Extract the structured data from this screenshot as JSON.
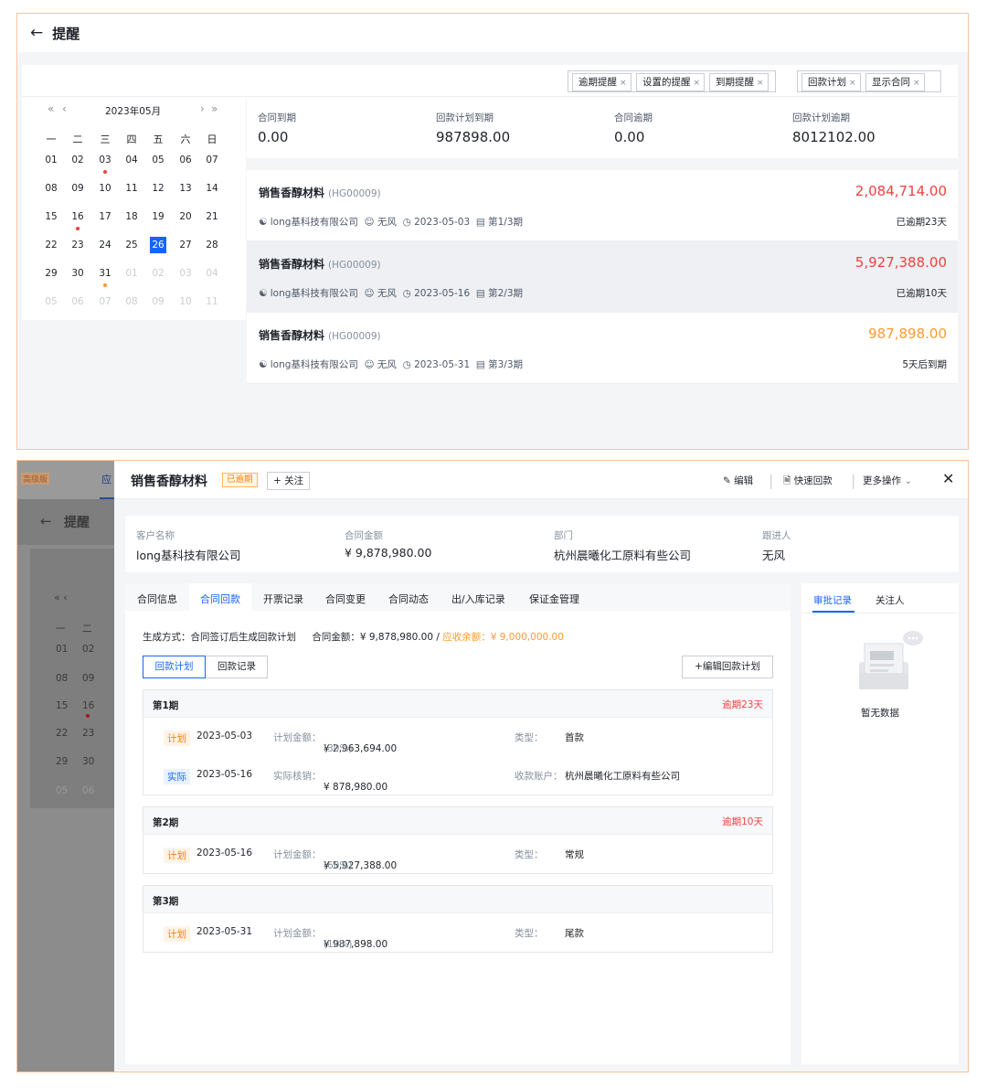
{
  "panel1": {
    "title": "提醒",
    "filters_a": [
      "逾期提醒",
      "设置的提醒",
      "到期提醒"
    ],
    "filters_b": [
      "回款计划",
      "显示合同"
    ],
    "calendar": {
      "month": "2023年05月",
      "weekdays": [
        "一",
        "二",
        "三",
        "四",
        "五",
        "六",
        "日"
      ],
      "weeks": [
        [
          "01",
          "02",
          "03",
          "04",
          "05",
          "06",
          "07"
        ],
        [
          "08",
          "09",
          "10",
          "11",
          "12",
          "13",
          "14"
        ],
        [
          "15",
          "16",
          "17",
          "18",
          "19",
          "20",
          "21"
        ],
        [
          "22",
          "23",
          "24",
          "25",
          "26",
          "27",
          "28"
        ],
        [
          "29",
          "30",
          "31",
          "01",
          "02",
          "03",
          "04"
        ],
        [
          "05",
          "06",
          "07",
          "08",
          "09",
          "10",
          "11"
        ]
      ],
      "selected": "26"
    },
    "stats": [
      {
        "label": "合同到期",
        "value": "0.00"
      },
      {
        "label": "回款计划到期",
        "value": "987898.00"
      },
      {
        "label": "合同逾期",
        "value": "0.00"
      },
      {
        "label": "回款计划逾期",
        "value": "8012102.00"
      }
    ],
    "rows": [
      {
        "name": "销售香醇材料",
        "code": "(HG00009)",
        "amount": "2,084,714.00",
        "company": "long基科技有限公司",
        "person": "无风",
        "date": "2023-05-03",
        "period": "第1/3期",
        "status": "已逾期23天",
        "color": "#f53f3f"
      },
      {
        "name": "销售香醇材料",
        "code": "(HG00009)",
        "amount": "5,927,388.00",
        "company": "long基科技有限公司",
        "person": "无风",
        "date": "2023-05-16",
        "period": "第2/3期",
        "status": "已逾期10天",
        "color": "#f53f3f"
      },
      {
        "name": "销售香醇材料",
        "code": "(HG00009)",
        "amount": "987,898.00",
        "company": "long基科技有限公司",
        "person": "无风",
        "date": "2023-05-31",
        "period": "第3/3期",
        "status": "5天后到期",
        "color": "#ff9a2e"
      }
    ]
  },
  "panel2": {
    "bg_nav": [
      "高级版",
      "应"
    ],
    "bg_title": "提醒",
    "bg_calendar_rows": [
      [
        "一",
        "二"
      ],
      [
        "01",
        "02"
      ],
      [
        "08",
        "09"
      ],
      [
        "15",
        "16"
      ],
      [
        "22",
        "23"
      ],
      [
        "29",
        "30"
      ],
      [
        "05",
        "06"
      ]
    ],
    "title": "销售香醇材料",
    "badge": "已逾期",
    "follow": "+ 关注",
    "actions": [
      "编辑",
      "快速回款",
      "更多操作"
    ],
    "info": [
      {
        "label": "客户名称",
        "value": "long基科技有限公司"
      },
      {
        "label": "合同金额",
        "value": "¥ 9,878,980.00"
      },
      {
        "label": "部门",
        "value": "杭州晨曦化工原料有些公司"
      },
      {
        "label": "跟进人",
        "value": "无风"
      }
    ],
    "tabs": [
      "合同信息",
      "合同回款",
      "开票记录",
      "合同变更",
      "合同动态",
      "出/入库记录",
      "保证金管理"
    ],
    "summary": {
      "gen_label": "生成方式：",
      "gen_value": "合同签订后生成回款计划",
      "amt_label": "合同金额：",
      "amt_value": "¥ 9,878,980.00",
      "sep": "/",
      "recv_label": "应收余额：",
      "recv_value": "¥ 9,000,000.00"
    },
    "sub_tabs": [
      "回款计划",
      "回款记录"
    ],
    "edit_btn": "+编辑回款计划",
    "periods": [
      {
        "name": "第1期",
        "overdue": "逾期23天",
        "lines": [
          {
            "badge": "计划",
            "date": "2023-05-03",
            "amt_label": "计划金额：",
            "amt": "¥ 2,963,694.00",
            "pct": "(30%)",
            "k_label": "类型：",
            "k_value": "首款"
          },
          {
            "badge": "实际",
            "date": "2023-05-16",
            "amt_label": "实际核销：",
            "amt": "¥ 878,980.00",
            "pct": "",
            "k_label": "收款账户：",
            "k_value": "杭州晨曦化工原料有些公司"
          }
        ]
      },
      {
        "name": "第2期",
        "overdue": "逾期10天",
        "lines": [
          {
            "badge": "计划",
            "date": "2023-05-16",
            "amt_label": "计划金额：",
            "amt": "¥ 5,927,388.00",
            "pct": "(60%)",
            "k_label": "类型：",
            "k_value": "常规"
          }
        ]
      },
      {
        "name": "第3期",
        "overdue": "",
        "lines": [
          {
            "badge": "计划",
            "date": "2023-05-31",
            "amt_label": "计划金额：",
            "amt": "¥ 987,898.00",
            "pct": "(10%)",
            "k_label": "类型：",
            "k_value": "尾款"
          }
        ]
      }
    ],
    "right_tabs": [
      "审批记录",
      "关注人"
    ],
    "empty": "暂无数据"
  },
  "colors": {
    "primary": "#1664ff",
    "danger": "#f53f3f",
    "warning": "#ff9a2e",
    "frame": "#f5c39f"
  }
}
